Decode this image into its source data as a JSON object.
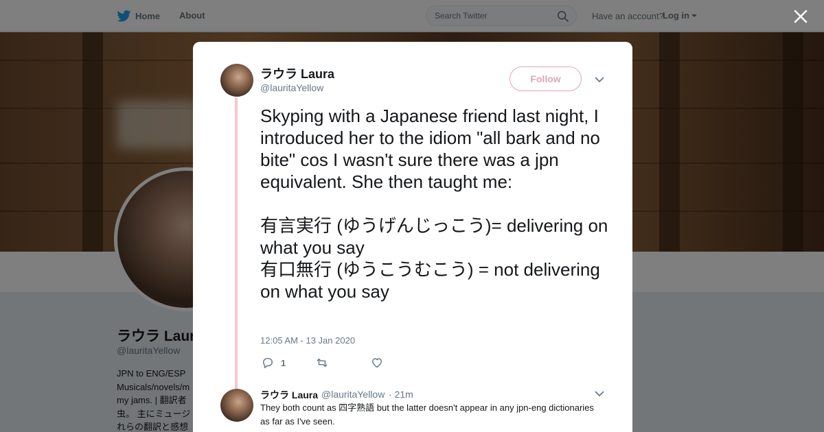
{
  "nav": {
    "home_label": "Home",
    "about_label": "About",
    "search_placeholder": "Search Twitter",
    "have_account": "Have an account?",
    "login_label": "Log in"
  },
  "profile": {
    "name": "ラウラ Laura",
    "handle": "@lauritaYellow",
    "bio_visible": "JPN to ENG/ESP\nMusicals/novels/m\nmy jams. | 翻訳者\n虫。 主にミュージ\nれらの翻訳と感想"
  },
  "tweet": {
    "author_name": "ラウラ Laura",
    "author_handle": "@lauritaYellow",
    "follow_label": "Follow",
    "text": "Skyping with a Japanese friend last night, I introduced her to the idiom \"all bark and no bite\" cos I wasn't sure there was a jpn equivalent. She then taught me:\n\n有言実行 (ゆうげんじっこう)= delivering on what you say\n有口無行 (ゆうこうむこう) = not delivering on what you say",
    "timestamp": "12:05 AM - 13 Jan 2020",
    "reply_count": "1",
    "retweet_count": "",
    "like_count": ""
  },
  "reply": {
    "author_name": "ラウラ Laura",
    "author_handle": "@lauritaYellow",
    "time": "· 21m",
    "text": "They both count as 四字熟語 but the latter doesn't appear in any jpn-eng dictionaries as far as I've seen."
  },
  "colors": {
    "accent_pink": "#e0a5b5",
    "thread_line": "#f5c6d1",
    "twitter_blue": "#1da1f2"
  },
  "icons": [
    "twitter-bird-icon",
    "search-icon",
    "close-icon",
    "chevron-down-icon",
    "reply-icon",
    "retweet-icon",
    "like-icon"
  ]
}
